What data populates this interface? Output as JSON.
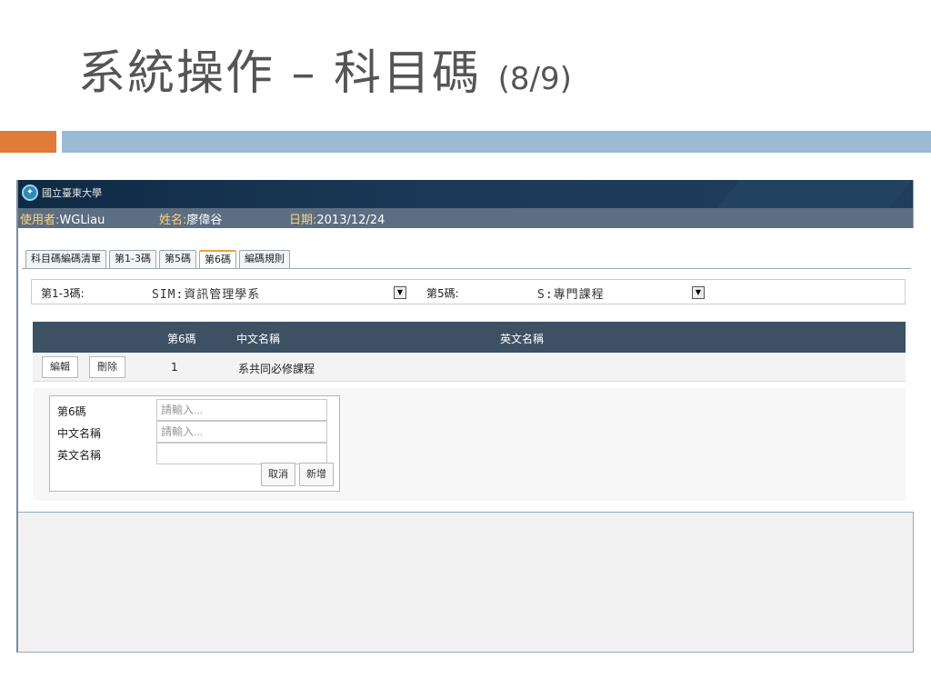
{
  "slide": {
    "title_main": "系統操作 – 科目碼",
    "title_page": "(8/9)"
  },
  "app": {
    "logo_text": "國立臺東大學",
    "user_label": "使用者:",
    "user_value": "WGLiau",
    "name_label": "姓名:",
    "name_value": "廖偉谷",
    "date_label": "日期:",
    "date_value": "2013/12/24",
    "tabs": [
      {
        "label": "科目碼編碼清單",
        "active": false
      },
      {
        "label": "第1-3碼",
        "active": false
      },
      {
        "label": "第5碼",
        "active": false
      },
      {
        "label": "第6碼",
        "active": true
      },
      {
        "label": "編碼規則",
        "active": false
      }
    ],
    "filter": {
      "code13_label": "第1-3碼:",
      "code13_value": "SIM:資訊管理學系",
      "code5_label": "第5碼:",
      "code5_value": "S:專門課程",
      "dropdown_glyph": "▼"
    },
    "grid": {
      "headers": [
        "第6碼",
        "中文名稱",
        "英文名稱"
      ],
      "rows": [
        {
          "edit": "編輯",
          "delete": "刪除",
          "code": "1",
          "zh_name": "系共同必修課程",
          "en_name": ""
        }
      ]
    },
    "form": {
      "code6_label": "第6碼",
      "code6_placeholder": "請輸入...",
      "zh_label": "中文名稱",
      "zh_placeholder": "請輸入...",
      "en_label": "英文名稱",
      "en_placeholder": "",
      "cancel_label": "取消",
      "add_label": "新增"
    }
  },
  "colors": {
    "accent_orange": "#E07B39",
    "accent_blue": "#9DBAD5",
    "header_dark": "#3d5064",
    "userbar": "#5c6e82"
  }
}
